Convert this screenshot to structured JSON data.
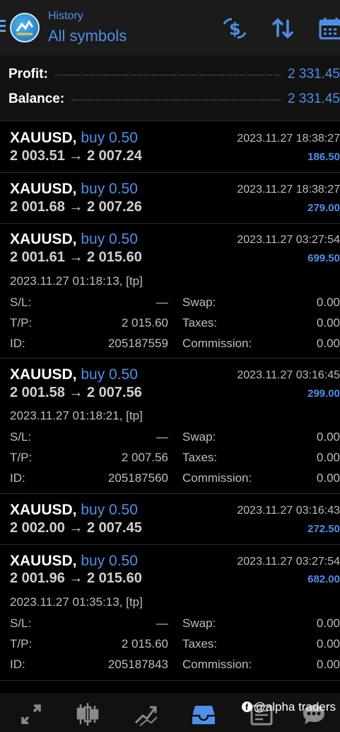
{
  "header": {
    "subtitle": "History",
    "title": "All symbols"
  },
  "summary": {
    "profit_label": "Profit:",
    "profit_value": "2 331.45",
    "balance_label": "Balance:",
    "balance_value": "2 331.45"
  },
  "trades": [
    {
      "symbol": "XAUUSD,",
      "direction": "buy 0.50",
      "prices": "2 003.51 → 2 007.24",
      "close_time": "2023.11.27 18:38:27",
      "profit": "186.50"
    },
    {
      "symbol": "XAUUSD,",
      "direction": "buy 0.50",
      "prices": "2 001.68 → 2 007.26",
      "close_time": "2023.11.27 18:38:27",
      "profit": "279.00"
    },
    {
      "symbol": "XAUUSD,",
      "direction": "buy 0.50",
      "prices": "2 001.61 → 2 015.60",
      "close_time": "2023.11.27 03:27:54",
      "profit": "699.50",
      "open_time": "2023.11.27 01:18:13, [tp]",
      "sl_label": "S/L:",
      "sl": "—",
      "tp_label": "T/P:",
      "tp": "2 015.60",
      "id_label": "ID:",
      "id": "205187559",
      "swap_label": "Swap:",
      "swap": "0.00",
      "taxes_label": "Taxes:",
      "taxes": "0.00",
      "commission_label": "Commission:",
      "commission": "0.00"
    },
    {
      "symbol": "XAUUSD,",
      "direction": "buy 0.50",
      "prices": "2 001.58 → 2 007.56",
      "close_time": "2023.11.27 03:16:45",
      "profit": "299.00",
      "open_time": "2023.11.27 01:18:21, [tp]",
      "sl_label": "S/L:",
      "sl": "—",
      "tp_label": "T/P:",
      "tp": "2 007.56",
      "id_label": "ID:",
      "id": "205187560",
      "swap_label": "Swap:",
      "swap": "0.00",
      "taxes_label": "Taxes:",
      "taxes": "0.00",
      "commission_label": "Commission:",
      "commission": "0.00"
    },
    {
      "symbol": "XAUUSD,",
      "direction": "buy 0.50",
      "prices": "2 002.00 → 2 007.45",
      "close_time": "2023.11.27 03:16:43",
      "profit": "272.50"
    },
    {
      "symbol": "XAUUSD,",
      "direction": "buy 0.50",
      "prices": "2 001.96 → 2 015.60",
      "close_time": "2023.11.27 03:27:54",
      "profit": "682.00",
      "open_time": "2023.11.27 01:35:13, [tp]",
      "sl_label": "S/L:",
      "sl": "—",
      "tp_label": "T/P:",
      "tp": "2 015.60",
      "id_label": "ID:",
      "id": "205187843",
      "swap_label": "Swap:",
      "swap": "0.00",
      "taxes_label": "Taxes:",
      "taxes": "0.00",
      "commission_label": "Commission:",
      "commission": "0.00"
    }
  ],
  "watermark": "@alpha traders",
  "icons": [
    "menu-icon",
    "app-logo-icon",
    "dollar-exchange-icon",
    "sort-icon",
    "calendar-icon",
    "quotes-icon",
    "chart-icon",
    "trade-icon",
    "history-icon",
    "news-icon",
    "messages-icon"
  ],
  "colors": {
    "accent": "#4f8fe8",
    "background": "#000000",
    "header": "#1b1b1b"
  }
}
